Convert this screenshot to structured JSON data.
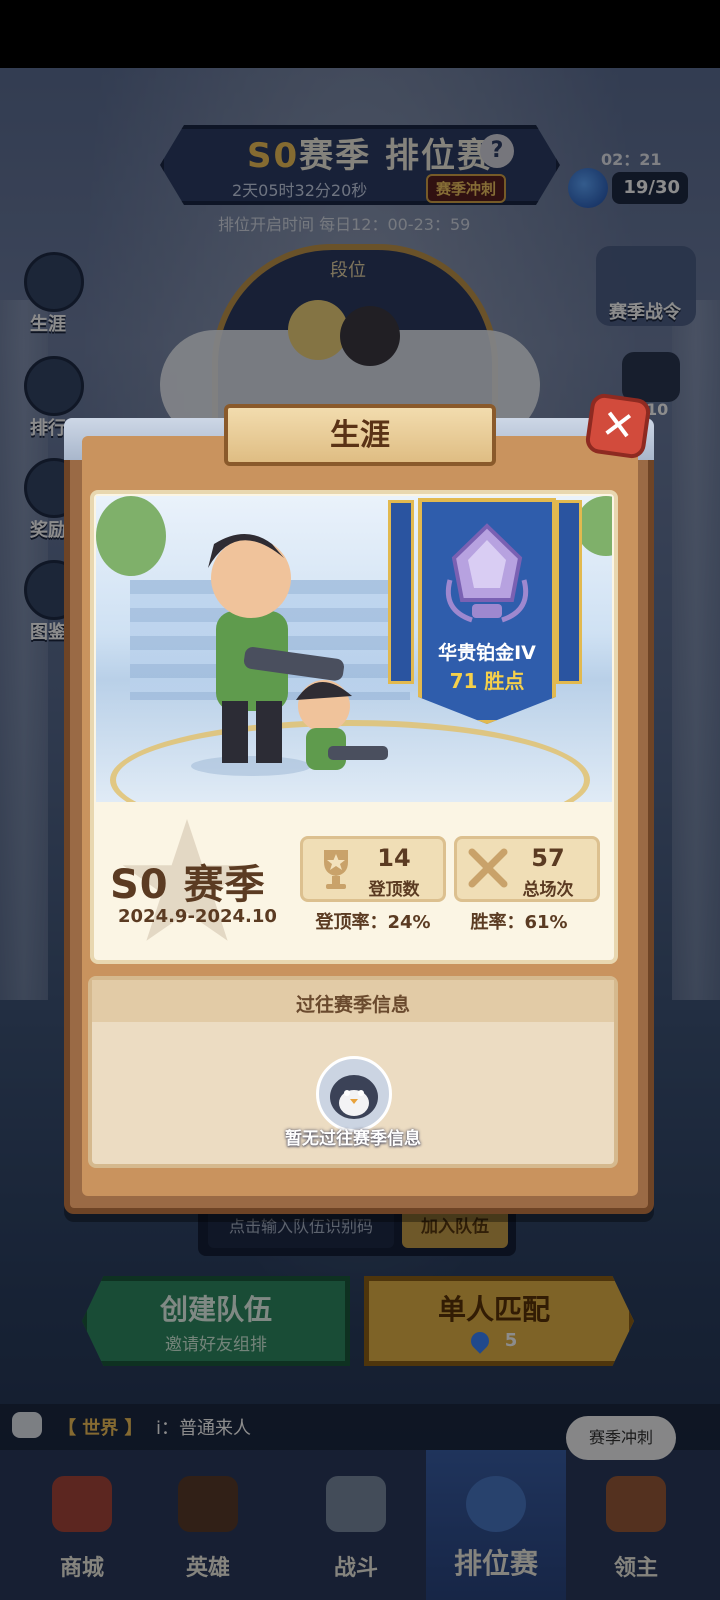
{
  "header": {
    "season_tag": "S0",
    "title_rest": "赛季 排位赛",
    "countdown": "2天05时32分20秒",
    "sprint_badge": "赛季冲刺",
    "open_time": "排位开启时间 每日12：00-23：59",
    "energy_timer": "02：21",
    "energy_count": "19/30"
  },
  "side_menu": {
    "career": "生涯",
    "ranking": "排行",
    "rewards": "奖励",
    "codex": "图鉴"
  },
  "right_menu": {
    "season_pass": "赛季战令",
    "gem_count": "10"
  },
  "arena": {
    "rank_label": "段位"
  },
  "modal": {
    "title": "生涯",
    "close_icon": "close-icon",
    "rank": {
      "name": "华贵铂金IV",
      "points": "71 胜点"
    },
    "season": {
      "name": "S0 赛季",
      "dates": "2024.9-2024.10"
    },
    "stats": [
      {
        "icon": "trophy-icon",
        "value": "14",
        "label": "登顶数"
      },
      {
        "icon": "crossed-swords-icon",
        "value": "57",
        "label": "总场次"
      }
    ],
    "rates": {
      "top_rate": "登顶率：24%",
      "win_rate": "胜率：61%"
    },
    "past": {
      "title": "过往赛季信息",
      "empty": "暂无过往赛季信息"
    }
  },
  "team": {
    "input_placeholder": "点击输入队伍识别码",
    "join_button": "加入队伍",
    "create_title": "创建队伍",
    "create_sub": "邀请好友组排",
    "solo_title": "单人匹配",
    "solo_cost": "5"
  },
  "chat": {
    "channel": "【 世界 】",
    "message": "i：普通来人",
    "bubble": "赛季冲刺"
  },
  "nav": [
    {
      "label": "商城",
      "icon": "shop-icon"
    },
    {
      "label": "英雄",
      "icon": "hero-card-icon"
    },
    {
      "label": "战斗",
      "icon": "battle-icon"
    },
    {
      "label": "排位赛",
      "icon": "ranked-shield-icon"
    },
    {
      "label": "领主",
      "icon": "lord-banner-icon"
    }
  ],
  "colors": {
    "modal_frame": "#9a6a45",
    "rank_banner": "#2f5dac",
    "accent_gold": "#f5d04a",
    "close_red": "#d24b3c",
    "create_green": "#2f8a63",
    "solo_gold": "#e5b447"
  }
}
